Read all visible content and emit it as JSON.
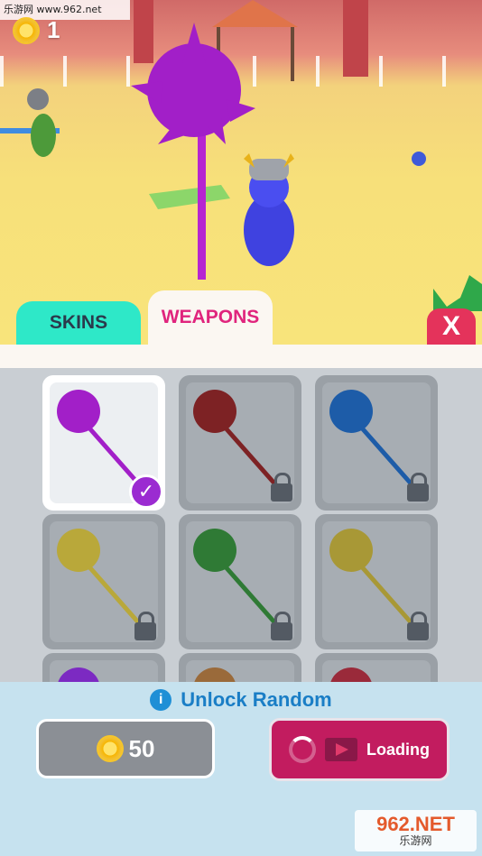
{
  "watermark_top": "乐游网 www.962.net",
  "hud": {
    "coin_count": "1",
    "coin_icon": "coin-icon"
  },
  "tabs": [
    {
      "label": "SKINS",
      "active": false
    },
    {
      "label": "WEAPONS",
      "active": true
    }
  ],
  "close_label": "X",
  "weapons": [
    {
      "name": "spiked-mace-purple",
      "color": "#a21fc8",
      "selected": true,
      "locked": false
    },
    {
      "name": "spiked-club-red",
      "color": "#7d2224",
      "selected": false,
      "locked": true
    },
    {
      "name": "halberd-blue",
      "color": "#1d5ca8",
      "selected": false,
      "locked": true
    },
    {
      "name": "golden-gauntlet-club",
      "color": "#b9a83a",
      "selected": false,
      "locked": true
    },
    {
      "name": "double-axe-green",
      "color": "#2f7a35",
      "selected": false,
      "locked": true
    },
    {
      "name": "war-pick-gold",
      "color": "#a89836",
      "selected": false,
      "locked": true
    },
    {
      "name": "purple-claw",
      "color": "#7c2ac2",
      "selected": false,
      "locked": true
    },
    {
      "name": "wooden-weapon",
      "color": "#9a6a3a",
      "selected": false,
      "locked": true
    },
    {
      "name": "red-blade",
      "color": "#9a2a3a",
      "selected": false,
      "locked": true
    }
  ],
  "unlock": {
    "info_icon": "i",
    "label": "Unlock Random"
  },
  "buy_button": {
    "price": "50"
  },
  "video_button": {
    "label": "Loading"
  },
  "watermark_bottom": {
    "big": "962.NET",
    "small": "乐游网"
  }
}
